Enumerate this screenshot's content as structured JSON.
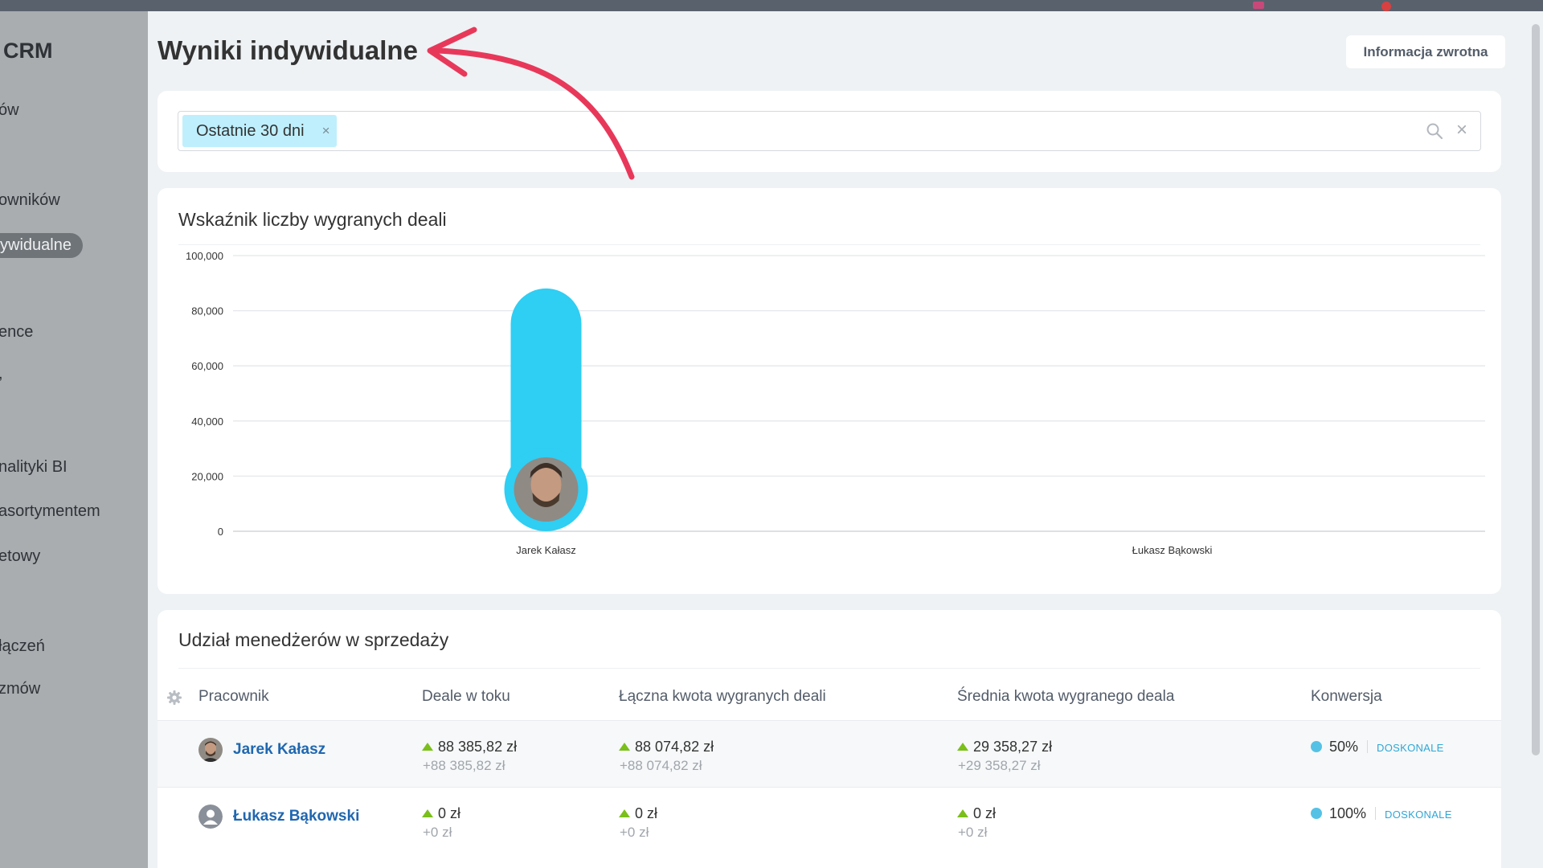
{
  "app": {
    "brand": "CRM"
  },
  "sidebar": {
    "items": [
      {
        "label": "ów"
      },
      {
        "label": "owników"
      },
      {
        "label": "ywidualne",
        "active": true
      },
      {
        "label": "ence"
      },
      {
        "label": ","
      },
      {
        "label": "nalityki BI"
      },
      {
        "label": "asortymentem"
      },
      {
        "label": "etowy"
      },
      {
        "label": "łączeń"
      },
      {
        "label": "zmów"
      }
    ]
  },
  "header": {
    "title": "Wyniki indywidualne",
    "feedback_label": "Informacja zwrotna"
  },
  "filter": {
    "tag_label": "Ostatnie 30 dni",
    "tag_remove": "×",
    "clear": "×"
  },
  "chart_card": {
    "title": "Wskaźnik liczby wygranych deali"
  },
  "chart_data": {
    "type": "bar",
    "categories": [
      "Jarek Kałasz",
      "Łukasz Bąkowski"
    ],
    "values": [
      88074.82,
      0
    ],
    "ylim": [
      0,
      100000
    ],
    "yticks": [
      0,
      20000,
      40000,
      60000,
      80000,
      100000
    ],
    "ytick_labels": [
      "0",
      "20,000",
      "40,000",
      "60,000",
      "80,000",
      "100,000"
    ],
    "grid": true,
    "bar_color": "#2fcef3"
  },
  "table": {
    "title": "Udział menedżerów w sprzedaży",
    "columns": [
      "Pracownik",
      "Deale w toku",
      "Łączna kwota wygranych deali",
      "Średnia kwota wygranego deala",
      "Konwersja"
    ],
    "rows": [
      {
        "name": "Jarek Kałasz",
        "in_progress": "88 385,82 zł",
        "in_progress_delta": "+88 385,82 zł",
        "won_total": "88 074,82 zł",
        "won_total_delta": "+88 074,82 zł",
        "won_avg": "29 358,27 zł",
        "won_avg_delta": "+29 358,27 zł",
        "conversion": "50%",
        "rating": "DOSKONALE"
      },
      {
        "name": "Łukasz Bąkowski",
        "in_progress": "0 zł",
        "in_progress_delta": "+0 zł",
        "won_total": "0 zł",
        "won_total_delta": "+0 zł",
        "won_avg": "0 zł",
        "won_avg_delta": "+0 zł",
        "conversion": "100%",
        "rating": "DOSKONALE"
      }
    ]
  },
  "colors": {
    "accent": "#2fcef3",
    "link": "#2067b0",
    "positive": "#7bbf1a",
    "annotation_arrow": "#e8385a"
  }
}
